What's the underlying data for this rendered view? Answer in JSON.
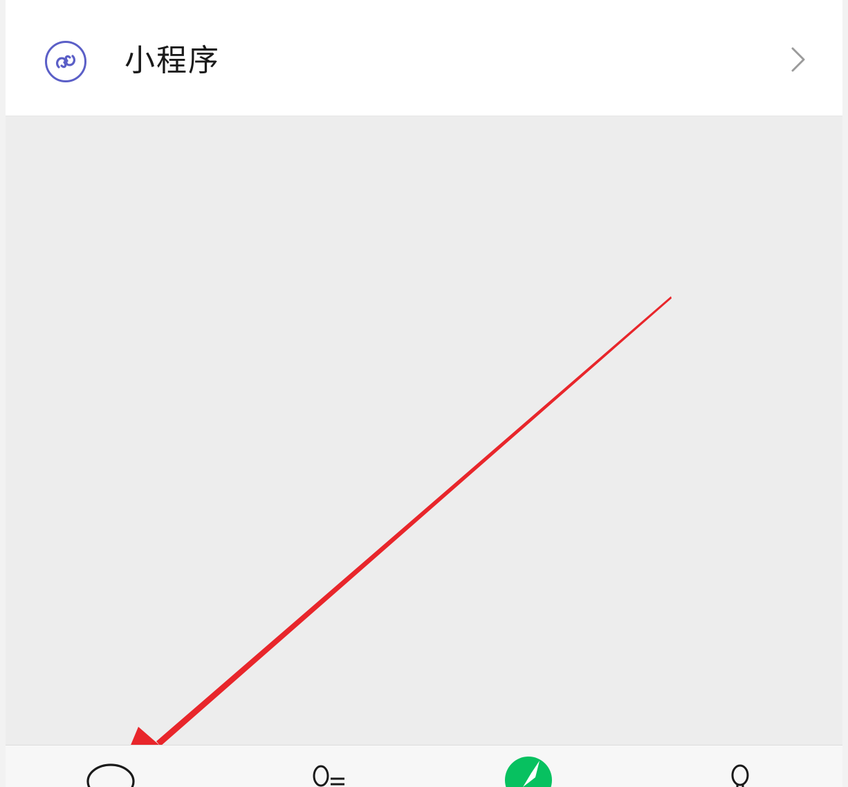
{
  "menu_item": {
    "label": "小程序",
    "icon": "mini-program-icon",
    "icon_color": "#5b5fc7"
  },
  "annotation": {
    "color": "#e8262b",
    "icon": "red-arrow"
  },
  "tabbar": {
    "tabs": [
      {
        "icon": "chat-bubble-icon"
      },
      {
        "icon": "contacts-icon"
      },
      {
        "icon": "discover-compass-icon",
        "color": "#07c160"
      },
      {
        "icon": "me-person-icon"
      }
    ]
  }
}
